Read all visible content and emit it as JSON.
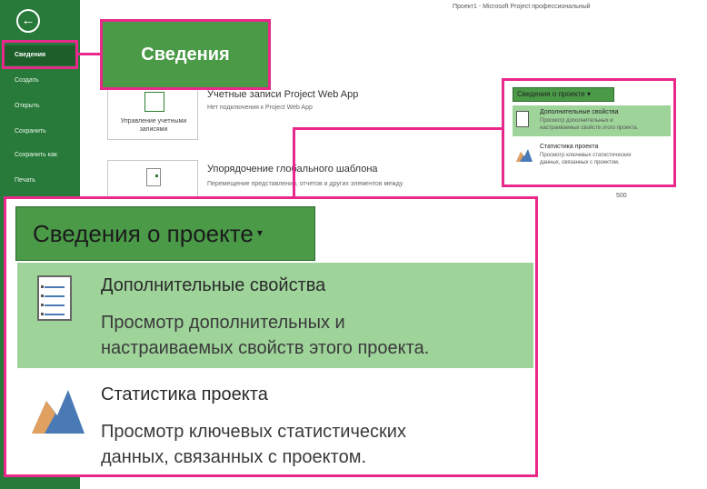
{
  "window": {
    "title": "Проект1 - Microsoft Project профессиональный"
  },
  "sidebar": {
    "back_glyph": "←",
    "items": [
      {
        "label": "Сведения"
      },
      {
        "label": "Создать"
      },
      {
        "label": "Открыть"
      },
      {
        "label": "Сохранить"
      },
      {
        "label": "Сохранить как"
      },
      {
        "label": "Печать"
      }
    ]
  },
  "callout": {
    "label": "Сведения"
  },
  "sections": [
    {
      "card_label": "Управление учетными записями",
      "title": "Учетные записи Project Web App",
      "description": "Нет подключения к Project Web App"
    },
    {
      "card_label": "",
      "title": "Упорядочение глобального шаблона",
      "description": "Перемещение представлений, отчетов и других элементов между"
    }
  ],
  "project_info_menu": {
    "button_label": "Сведения о проекте",
    "caret": "▾",
    "items": [
      {
        "title": "Дополнительные свойства",
        "description_line1": "Просмотр дополнительных и",
        "description_line2": "настраиваемых свойств этого проекта.",
        "icon": "list-icon"
      },
      {
        "title": "Статистика проекта",
        "description_line1": "Просмотр ключевых статистических",
        "description_line2": "данных, связанных с проектом.",
        "icon": "mountain-icon"
      }
    ]
  },
  "background_stats": {
    "value": "500"
  },
  "colors": {
    "sidebar_green": "#287a3a",
    "button_green": "#4a9a48",
    "highlight_row": "#9ed39a",
    "annotation_magenta": "#e8288a",
    "icon_blue": "#4a7ab5",
    "icon_tan": "#e0a060"
  }
}
